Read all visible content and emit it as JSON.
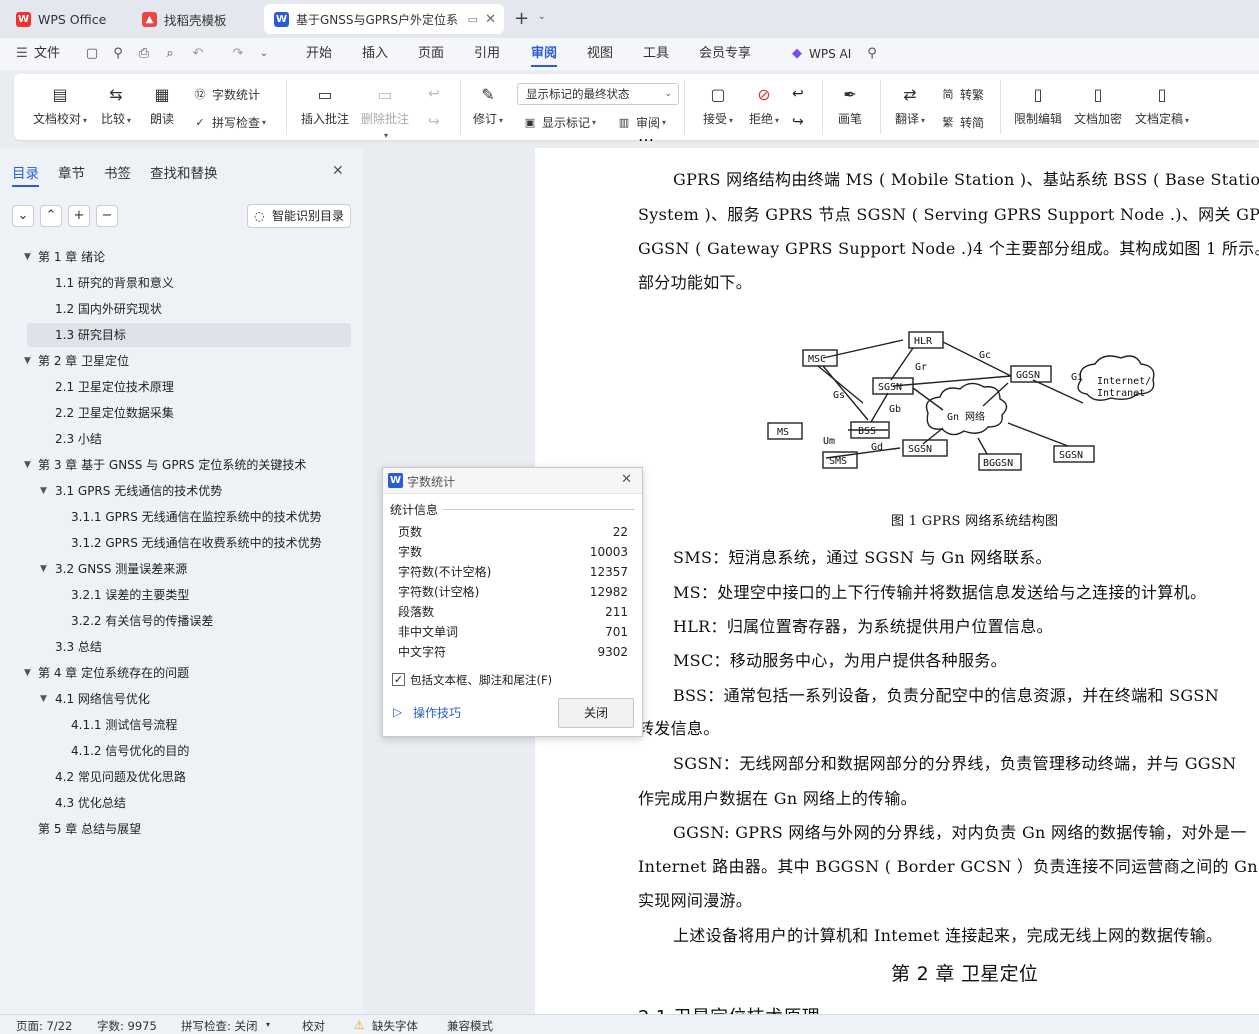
{
  "tabs": [
    {
      "label": "WPS Office",
      "icon": "wps-logo-icon"
    },
    {
      "label": "找稻壳模板",
      "icon": "docer-icon"
    },
    {
      "label": "基于GNSS与GPRS户外定位系",
      "icon": "writer-doc-icon"
    }
  ],
  "menu": {
    "file": "文件",
    "items": [
      "开始",
      "插入",
      "页面",
      "引用",
      "审阅",
      "视图",
      "工具",
      "会员专享"
    ],
    "active": "审阅",
    "wps_ai": "WPS AI"
  },
  "ribbon": {
    "doc_check": "文档校对",
    "compare": "比较",
    "read_aloud": "朗读",
    "word_count": "字数统计",
    "spell_check": "拼写检查",
    "insert_comment": "插入批注",
    "delete_comment": "删除批注",
    "revise": "修订",
    "markup_state": "显示标记的最终状态",
    "show_markup": "显示标记",
    "review": "审阅",
    "accept": "接受",
    "reject": "拒绝",
    "pen": "画笔",
    "translate": "翻译",
    "to_traditional": "转繁",
    "to_simplified": "转简",
    "restrict_edit": "限制编辑",
    "encrypt": "文档加密",
    "finalize": "文档定稿"
  },
  "nav": {
    "tabs": [
      "目录",
      "章节",
      "书签",
      "查找和替换"
    ],
    "smart_toc": "智能识别目录",
    "toc": [
      {
        "label": "第 1 章 绪论",
        "level": 1,
        "expanded": true
      },
      {
        "label": "1.1 研究的背景和意义",
        "level": 2
      },
      {
        "label": "1.2 国内外研究现状",
        "level": 2
      },
      {
        "label": "1.3 研究目标",
        "level": 2,
        "selected": true
      },
      {
        "label": "第 2 章 卫星定位",
        "level": 1,
        "expanded": true
      },
      {
        "label": "2.1 卫星定位技术原理",
        "level": 2
      },
      {
        "label": "2.2 卫星定位数据采集",
        "level": 2
      },
      {
        "label": "2.3 小结",
        "level": 2
      },
      {
        "label": "第 3 章 基于 GNSS 与 GPRS 定位系统的关键技术",
        "level": 1,
        "expanded": true
      },
      {
        "label": "3.1 GPRS 无线通信的技术优势",
        "level": 2,
        "expanded": true
      },
      {
        "label": "3.1.1 GPRS 无线通信在监控系统中的技术优势",
        "level": 3
      },
      {
        "label": "3.1.2 GPRS 无线通信在收费系统中的技术优势",
        "level": 3
      },
      {
        "label": "3.2 GNSS 测量误差来源",
        "level": 2,
        "expanded": true
      },
      {
        "label": "3.2.1 误差的主要类型",
        "level": 3
      },
      {
        "label": "3.2.2 有关信号的传播误差",
        "level": 3
      },
      {
        "label": "3.3 总结",
        "level": 2
      },
      {
        "label": "第 4 章 定位系统存在的问题",
        "level": 1,
        "expanded": true
      },
      {
        "label": "4.1 网络信号优化",
        "level": 2,
        "expanded": true
      },
      {
        "label": "4.1.1 测试信号流程",
        "level": 3
      },
      {
        "label": "4.1.2 信号优化的目的",
        "level": 3
      },
      {
        "label": "4.2 常见问题及优化思路",
        "level": 2
      },
      {
        "label": "4.3 优化总结",
        "level": 2
      },
      {
        "label": "第 5 章 总结与展望",
        "level": 1
      }
    ]
  },
  "dialog": {
    "title": "字数统计",
    "section": "统计信息",
    "rows": [
      {
        "label": "页数",
        "value": "22"
      },
      {
        "label": "字数",
        "value": "10003"
      },
      {
        "label": "字符数(不计空格)",
        "value": "12357"
      },
      {
        "label": "字符数(计空格)",
        "value": "12982"
      },
      {
        "label": "段落数",
        "value": "211"
      },
      {
        "label": "非中文单词",
        "value": "701"
      },
      {
        "label": "中文字符",
        "value": "9302"
      }
    ],
    "checkbox": "包括文本框、脚注和尾注(F)",
    "checkbox_checked": true,
    "tips": "操作技巧",
    "close": "关闭"
  },
  "document": {
    "lines": [
      "GPRS  网络结构由终端  MS ( Mobile Station )、基站系统  BSS ( Base Station",
      "System )、服务  GPRS  节点  SGSN ( Serving GPRS Support Node .)、网关  GPRS  节",
      "GGSN ( Gateway GPRS Support Node .)4 个主要部分组成。其构成如图 1 所示。图",
      "部分功能如下。"
    ],
    "figure_labels": {
      "hlr": "HLR",
      "msc": "MSC",
      "sgsn1": "SGSN",
      "ggsn": "GGSN",
      "internet": "Internet/",
      "intranet": "Intranet",
      "gn": "Gn 网络",
      "ms": "MS",
      "bss": "BSS",
      "sms": "SMS",
      "sgsn2": "SGSN",
      "bggsn": "BGGSN",
      "sgsn3": "SGSN",
      "gr": "Gr",
      "gc": "Gc",
      "gi": "Gi",
      "gs": "Gs",
      "gb": "Gb",
      "um": "Um",
      "gd": "Gd"
    },
    "caption": "图 1    GPRS 网络系统结构图",
    "paras": [
      "SMS：短消息系统，通过  SGSN 与 Gn 网络联系。",
      "MS：处理空中接口的上下行传输并将数据信息发送给与之连接的计算机。",
      "HLR：归属位置寄存器，为系统提供用户位置信息。",
      "MSC：移动服务中心，为用户提供各种服务。",
      "BSS：通常包括一系列设备，负责分配空中的信息资源，并在终端和  SGSN",
      "转发信息。",
      "SGSN：无线网部分和数据网部分的分界线，负责管理移动终端，并与 GGSN",
      "作完成用户数据在 Gn 网络上的传输。",
      "GGSN: GPRS 网络与外网的分界线，对内负责  Gn 网络的数据传输，对外是一",
      "Internet  路由器。其中  BGGSN ( Border GCSN ）负责连接不同运营商之间的  Gn",
      "实现网间漫游。",
      "上述设备将用户的计算机和 Intemet 连接起来，完成无线上网的数据传输。"
    ],
    "heading": "第 2 章  卫星定位",
    "partial": "2.1  卫星定位技术原理"
  },
  "status": {
    "page": "页面: 7/22",
    "words": "字数: 9975",
    "spell": "拼写检查: 关闭",
    "proof": "校对",
    "missing_font": "缺失字体",
    "compat": "兼容模式"
  }
}
